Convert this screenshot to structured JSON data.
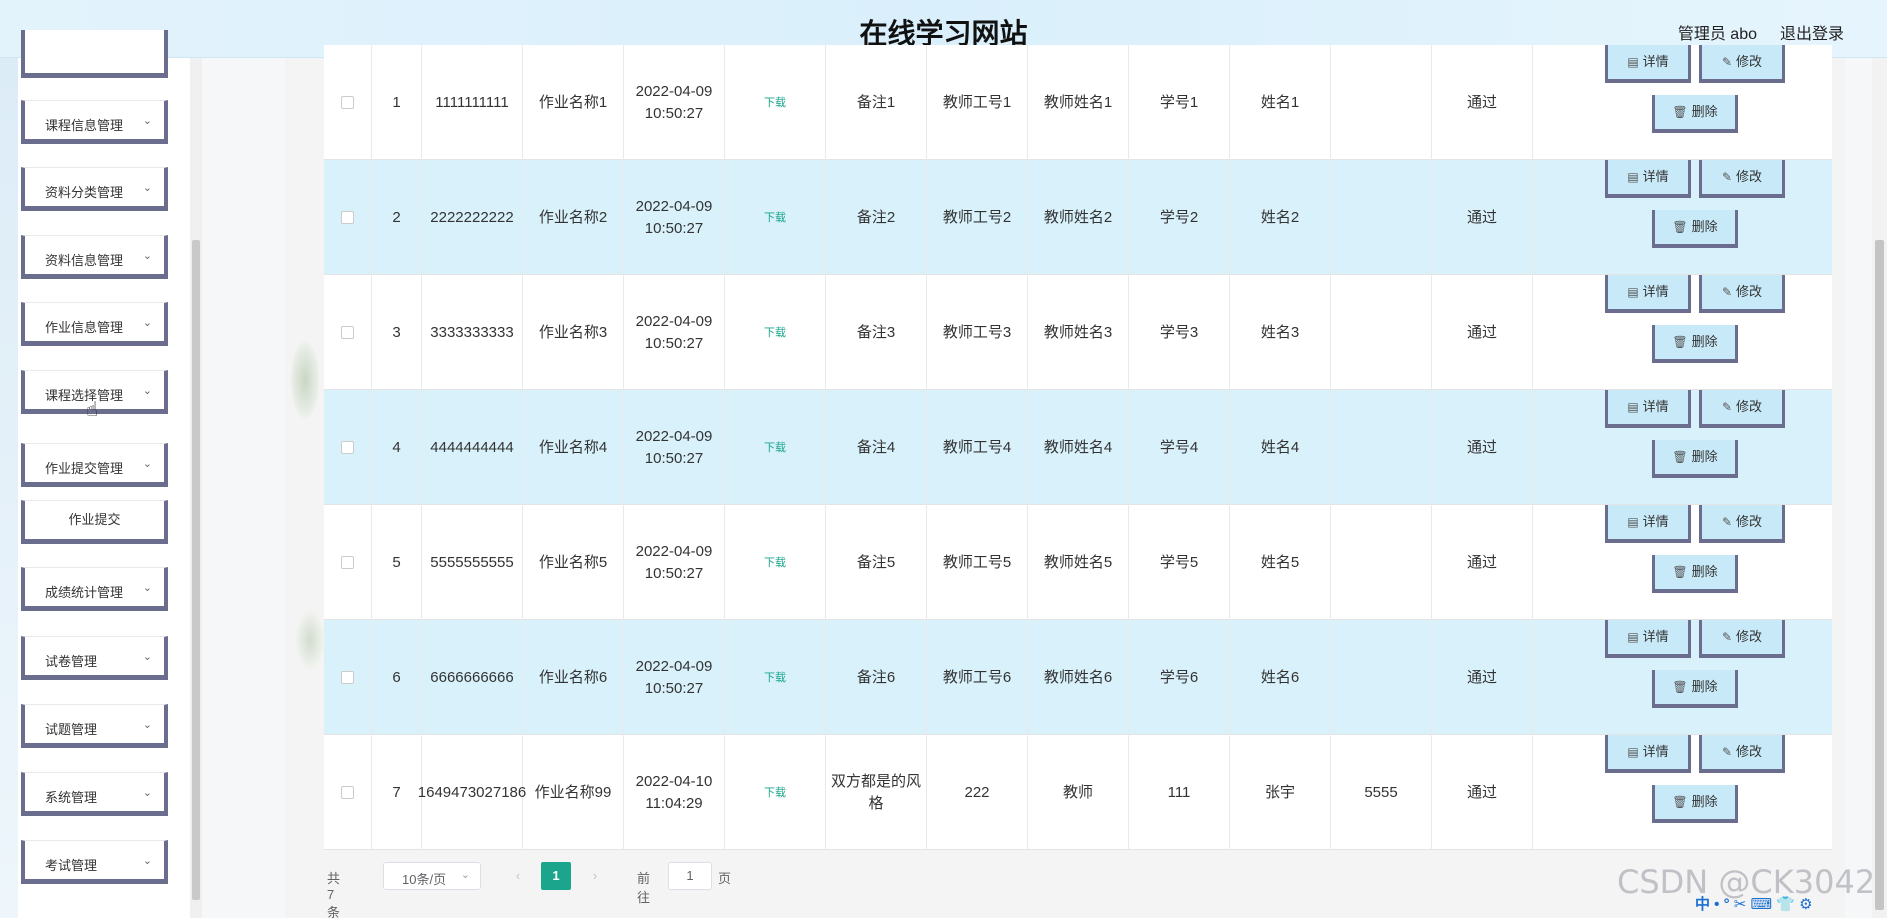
{
  "header": {
    "title": "在线学习网站",
    "user": "管理员 abo",
    "logout": "退出登录"
  },
  "sidebar": {
    "items": [
      {
        "label": "课程信息管理"
      },
      {
        "label": "资料分类管理"
      },
      {
        "label": "资料信息管理"
      },
      {
        "label": "作业信息管理"
      },
      {
        "label": "课程选择管理"
      },
      {
        "label": "作业提交管理"
      },
      {
        "label": "作业提交",
        "sub": true
      },
      {
        "label": "成绩统计管理"
      },
      {
        "label": "试卷管理"
      },
      {
        "label": "试题管理"
      },
      {
        "label": "系统管理"
      },
      {
        "label": "考试管理"
      }
    ]
  },
  "table": {
    "download_label": "下载",
    "detail_label": "详情",
    "edit_label": "修改",
    "delete_label": "删除",
    "rows": [
      {
        "index": "1",
        "no": "1111111111",
        "name": "作业名称1",
        "time": "2022-04-09 10:50:27",
        "remark": "备注1",
        "teacher_id": "教师工号1",
        "teacher_name": "教师姓名1",
        "student_id": "学号1",
        "student_name": "姓名1",
        "score": "",
        "status": "通过"
      },
      {
        "index": "2",
        "no": "2222222222",
        "name": "作业名称2",
        "time": "2022-04-09 10:50:27",
        "remark": "备注2",
        "teacher_id": "教师工号2",
        "teacher_name": "教师姓名2",
        "student_id": "学号2",
        "student_name": "姓名2",
        "score": "",
        "status": "通过"
      },
      {
        "index": "3",
        "no": "3333333333",
        "name": "作业名称3",
        "time": "2022-04-09 10:50:27",
        "remark": "备注3",
        "teacher_id": "教师工号3",
        "teacher_name": "教师姓名3",
        "student_id": "学号3",
        "student_name": "姓名3",
        "score": "",
        "status": "通过"
      },
      {
        "index": "4",
        "no": "4444444444",
        "name": "作业名称4",
        "time": "2022-04-09 10:50:27",
        "remark": "备注4",
        "teacher_id": "教师工号4",
        "teacher_name": "教师姓名4",
        "student_id": "学号4",
        "student_name": "姓名4",
        "score": "",
        "status": "通过"
      },
      {
        "index": "5",
        "no": "5555555555",
        "name": "作业名称5",
        "time": "2022-04-09 10:50:27",
        "remark": "备注5",
        "teacher_id": "教师工号5",
        "teacher_name": "教师姓名5",
        "student_id": "学号5",
        "student_name": "姓名5",
        "score": "",
        "status": "通过"
      },
      {
        "index": "6",
        "no": "6666666666",
        "name": "作业名称6",
        "time": "2022-04-09 10:50:27",
        "remark": "备注6",
        "teacher_id": "教师工号6",
        "teacher_name": "教师姓名6",
        "student_id": "学号6",
        "student_name": "姓名6",
        "score": "",
        "status": "通过"
      },
      {
        "index": "7",
        "no": "1649473027186",
        "name": "作业名称99",
        "time": "2022-04-10 11:04:29",
        "remark": "双方都是的风格",
        "teacher_id": "222",
        "teacher_name": "教师",
        "student_id": "111",
        "student_name": "张宇",
        "score": "5555",
        "status": "通过"
      }
    ]
  },
  "pagination": {
    "total": "共 7 条",
    "page_size": "10条/页",
    "current": "1",
    "goto_prefix": "前往",
    "goto_value": "1",
    "goto_suffix": "页",
    "prev_icon": "chevron-left-icon",
    "next_icon": "chevron-right-icon"
  },
  "watermark": "CSDN @CK3042",
  "ime_bar": "中 • ° ✂ ⌨ 👕 ⚙",
  "colors": {
    "accent": "#1aa58c",
    "row_alt": "#d8f1fb",
    "button": "#c7e9f8",
    "border_dark": "#6b6d8e"
  }
}
